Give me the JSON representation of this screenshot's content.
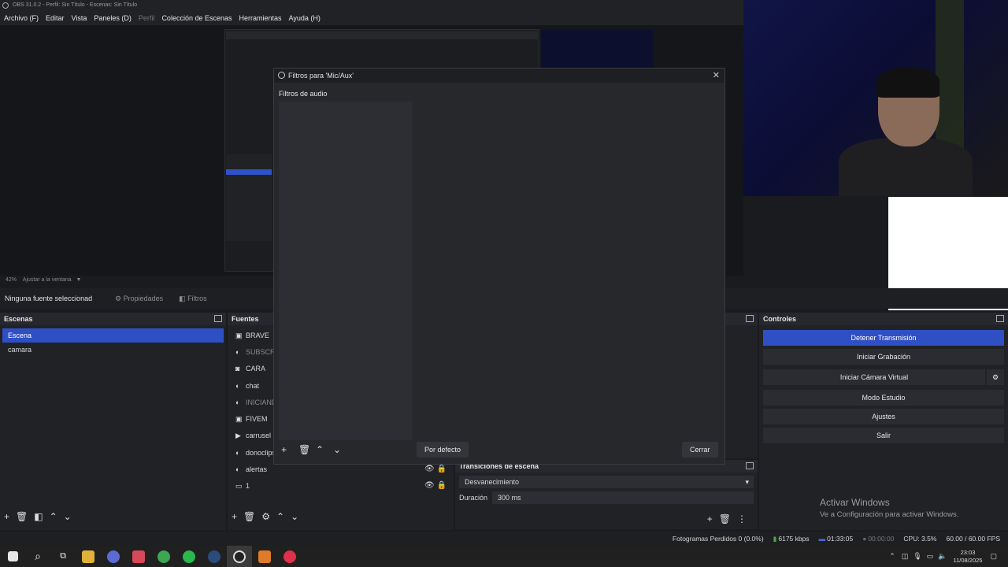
{
  "window": {
    "title": "OBS 31.0.2 - Perfil: Sin Título - Escenas: Sin Título"
  },
  "menu": [
    "Archivo (F)",
    "Editar",
    "Vista",
    "Paneles (D)",
    "Perfil",
    "Colección de Escenas",
    "Herramientas",
    "Ayuda (H)"
  ],
  "preview": {
    "zoom": "42%",
    "fit": "Ajustar a la ventana"
  },
  "source_toolbar": {
    "none_selected": "Ninguna fuente seleccionad",
    "properties": "Propiedades",
    "filters": "Filtros"
  },
  "scenes": {
    "title": "Escenas",
    "items": [
      "Escena",
      "camara"
    ],
    "selected": 0
  },
  "sources": {
    "title": "Fuentes",
    "items": [
      {
        "label": "BRAVE",
        "icon": "window-icon",
        "dim": false
      },
      {
        "label": "SUBSCRIB",
        "icon": "browser-icon",
        "dim": true
      },
      {
        "label": "CARA",
        "icon": "camera-icon",
        "dim": false
      },
      {
        "label": "chat",
        "icon": "browser-icon",
        "dim": false
      },
      {
        "label": "INICIAND",
        "icon": "browser-icon",
        "dim": true
      },
      {
        "label": "FIVEM",
        "icon": "window-icon",
        "dim": false
      },
      {
        "label": "carrusel",
        "icon": "play-icon",
        "dim": false
      },
      {
        "label": "donoclips",
        "icon": "browser-icon",
        "dim": false
      },
      {
        "label": "alertas",
        "icon": "browser-icon",
        "dim": false
      },
      {
        "label": "1",
        "icon": "monitor-icon",
        "dim": false
      }
    ]
  },
  "dialog": {
    "title": "Filtros para 'Mic/Aux'",
    "section": "Filtros de audio",
    "defaults": "Por defecto",
    "close": "Cerrar"
  },
  "transitions": {
    "title": "Transiciones de escena",
    "selected": "Desvanecimiento",
    "duration_label": "Duración",
    "duration_value": "300 ms"
  },
  "controls": {
    "title": "Controles",
    "buttons": [
      "Detener Transmisión",
      "Iniciar Grabación",
      "Iniciar Cámara Virtual",
      "Modo Estudio",
      "Ajustes",
      "Salir"
    ]
  },
  "status": {
    "dropped": "Fotogramas Perdidos 0 (0.0%)",
    "bitrate": "6175 kbps",
    "stream_time": "01:33:05",
    "rec_time": "00:00:00",
    "cpu": "CPU: 3.5%",
    "fps": "60.00 / 60.00 FPS"
  },
  "watermark": {
    "line1": "Activar Windows",
    "line2": "Ve a Configuración para activar Windows."
  },
  "clock": {
    "time": "23:03",
    "date": "11/08/2025"
  },
  "colors": {
    "accent": "#2f4fc4",
    "bg": "#1a1b1f",
    "panel": "#202226"
  }
}
